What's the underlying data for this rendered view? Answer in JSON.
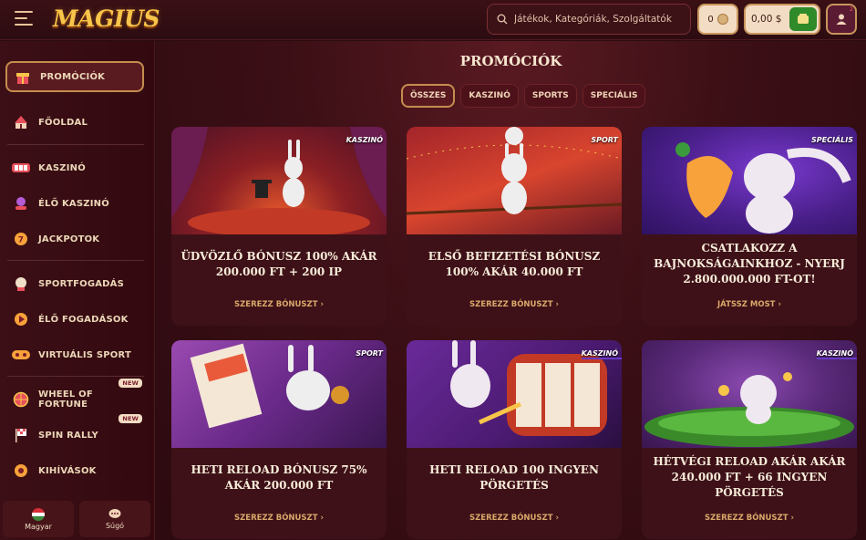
{
  "header": {
    "logo": "MAGIUS",
    "search_placeholder": "Játékok, Kategóriák, Szolgáltatók",
    "coins": "0",
    "balance": "0,00 $",
    "profile_badge": "2"
  },
  "sidebar": {
    "items": [
      {
        "label": "PROMÓCIÓK",
        "icon": "gift-icon"
      },
      {
        "label": "FŐOLDAL",
        "icon": "circus-tent-icon"
      },
      {
        "label": "KASZINÓ",
        "icon": "slot-reels-icon"
      },
      {
        "label": "ÉLŐ KASZINÓ",
        "icon": "live-dealer-icon"
      },
      {
        "label": "JACKPOTOK",
        "icon": "jackpot-coin-icon"
      },
      {
        "label": "SPORTFOGADÁS",
        "icon": "sports-ball-icon"
      },
      {
        "label": "ÉLŐ FOGADÁSOK",
        "icon": "live-bet-icon"
      },
      {
        "label": "VIRTUÁLIS SPORT",
        "icon": "gamepad-icon"
      },
      {
        "label": "WHEEL OF FORTUNE",
        "icon": "wheel-icon",
        "badge": "NEW"
      },
      {
        "label": "SPIN RALLY",
        "icon": "checkered-flag-icon",
        "badge": "NEW"
      },
      {
        "label": "KIHÍVÁSOK",
        "icon": "challenge-icon"
      }
    ],
    "language": "Magyar",
    "help": "Súgó"
  },
  "main": {
    "title": "PROMÓCIÓK",
    "tabs": [
      "ÖSSZES",
      "KASZINÓ",
      "SPORTS",
      "SPECIÁLIS"
    ],
    "cards": [
      {
        "tag": "KASZINÓ",
        "title": "ÜDVÖZLŐ BÓNUSZ 100% AKÁR 200.000 FT + 200 IP",
        "cta": "SZEREZZ BÓNUSZT"
      },
      {
        "tag": "SPORT",
        "title": "ELSŐ BEFIZETÉSI BÓNUSZ 100% AKÁR 40.000 FT",
        "cta": "SZEREZZ BÓNUSZT"
      },
      {
        "tag": "SPECIÁLIS",
        "title": "CSATLAKOZZ A BAJNOKSÁGAINKHOZ - NYERJ 2.800.000.000 FT-OT!",
        "cta": "JÁTSSZ MOST"
      },
      {
        "tag": "SPORT",
        "title": "HETI RELOAD BÓNUSZ 75% AKÁR 200.000 FT",
        "cta": "SZEREZZ BÓNUSZT"
      },
      {
        "tag": "KASZINÓ",
        "title": "HETI RELOAD 100 INGYEN PÖRGETÉS",
        "cta": "SZEREZZ BÓNUSZT"
      },
      {
        "tag": "KASZINÓ",
        "title": "HÉTVÉGI RELOAD AKÁR AKÁR 240.000 FT + 66 INGYEN PÖRGETÉS",
        "cta": "SZEREZZ BÓNUSZT"
      }
    ]
  }
}
